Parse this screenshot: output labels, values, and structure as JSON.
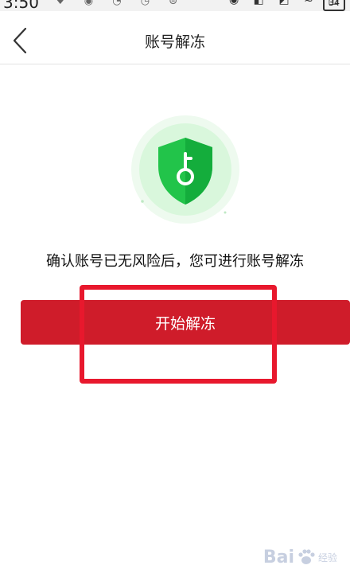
{
  "status_bar": {
    "time": "3:50",
    "battery": "34",
    "left_icons": "♥ ◉ ◔ ◷ ⊜",
    "right_icons": "◉ ◧ ◩ ≈ ◫"
  },
  "navbar": {
    "back_icon": "chevron-left-icon",
    "title": "账号解冻"
  },
  "hero": {
    "icon": "shield-key-icon",
    "shield_color": "#22c44a",
    "halo_color": "#d9f7dc"
  },
  "message": "确认账号已无风险后，您可进行账号解冻",
  "primary_button": {
    "label": "开始解冻",
    "color": "#cf1c2a"
  },
  "annotation": {
    "color": "#e8182d"
  },
  "watermark": {
    "brand": "Bai",
    "tail": "经验"
  }
}
